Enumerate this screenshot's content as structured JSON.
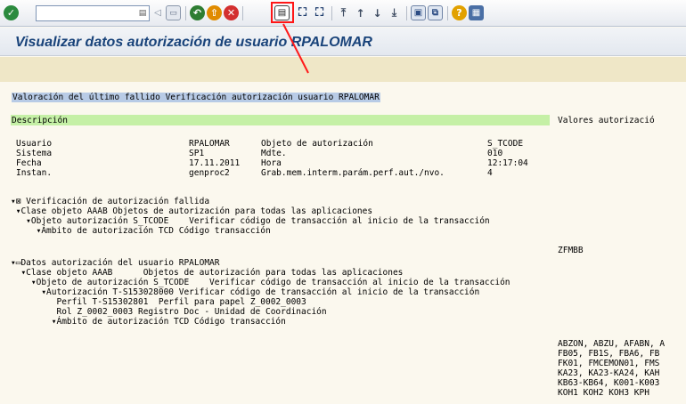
{
  "toolbar": {
    "icons": [
      "enter-icon",
      "back-icon",
      "exit-icon",
      "cancel-icon",
      "print-icon",
      "find-icon",
      "find-next-icon",
      "first-page-icon",
      "previous-page-icon",
      "next-page-icon",
      "last-page-icon",
      "create-session-icon",
      "shortcut-icon",
      "help-icon",
      "customize-layout-icon"
    ],
    "command_value": ""
  },
  "title": "Visualizar datos autorización de usuario RPALOMAR",
  "report": {
    "heading": "Valoración del último fallido Verificación autorización usuario RPALOMAR",
    "col_descripcion": "Descripción",
    "col_valores": "Valores autorizació",
    "info": [
      {
        "label": "Usuario",
        "value": "RPALOMAR",
        "label2": "Objeto de autorización",
        "value2": "S_TCODE"
      },
      {
        "label": "Sistema",
        "value": "SP1",
        "label2": "Mdte.",
        "value2": "010"
      },
      {
        "label": "Fecha",
        "value": "17.11.2011",
        "label2": "Hora",
        "value2": "12:17:04"
      },
      {
        "label": "Instan.",
        "value": "genproc2",
        "label2": "Grab.mem.interm.parám.perf.aut./nvo.",
        "value2": "4"
      }
    ],
    "failed_tree": [
      "▾⊠ Verificación de autorización fallida",
      " ▾Clase objeto AAAB Objetos de autorización para todas las aplicaciones",
      "   ▾Objeto autorización S_TCODE    Verificar código de transacción al inicio de la transacción",
      "     ▾Ámbito de autorización TCD Código transacción"
    ],
    "failed_value": "ZFMBB",
    "data_tree": [
      "▾▭Datos autorización del usuario RPALOMAR",
      "  ▾Clase objeto AAAB      Objetos de autorización para todas las aplicaciones",
      "    ▾Objeto de autorización S_TCODE    Verificar código de transacción al inicio de la transacción",
      "      ▾Autorización T-S153028000 Verificar código de transacción al inicio de la transacción",
      "         Perfil T-S15302801  Perfil para papel Z_0002_0003",
      "         Rol Z_0002_0003 Registro Doc - Unidad de Coordinación",
      "        ▾Ámbito de autorización TCD Código transacción"
    ],
    "values_list": [
      "ABZON, ABZU, AFABN, A",
      "FB05, FB1S, FBA6, FB",
      "FK01, FMCEMON01, FMS",
      "KA23, KA23-KA24, KAH",
      "KB63-KB64, K001-K003",
      "KOH1 KOH2 KOH3 KPH"
    ]
  }
}
